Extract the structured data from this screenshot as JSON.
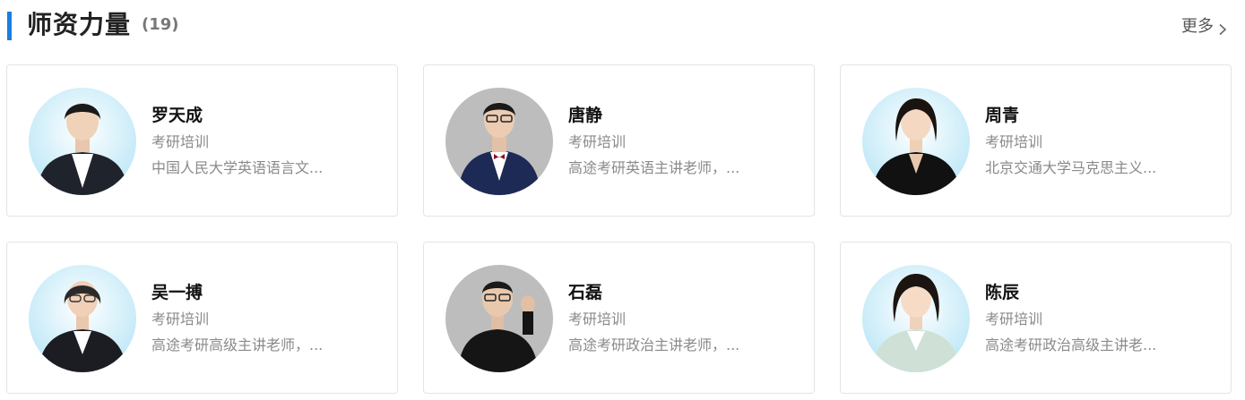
{
  "section": {
    "title": "师资力量",
    "count": "(19)",
    "more_label": "更多"
  },
  "colors": {
    "accent": "#1a7fe0",
    "avatar_bg_light": "#d6f0fb",
    "avatar_bg_gray": "#bdbdbd"
  },
  "teachers": [
    {
      "name": "罗天成",
      "category": "考研培训",
      "desc": "中国人民大学英语语言文..."
    },
    {
      "name": "唐静",
      "category": "考研培训",
      "desc": "高途考研英语主讲老师，..."
    },
    {
      "name": "周青",
      "category": "考研培训",
      "desc": "北京交通大学马克思主义..."
    },
    {
      "name": "吴一搏",
      "category": "考研培训",
      "desc": "高途考研高级主讲老师，..."
    },
    {
      "name": "石磊",
      "category": "考研培训",
      "desc": "高途考研政治主讲老师，..."
    },
    {
      "name": "陈辰",
      "category": "考研培训",
      "desc": "高途考研政治高级主讲老..."
    }
  ]
}
